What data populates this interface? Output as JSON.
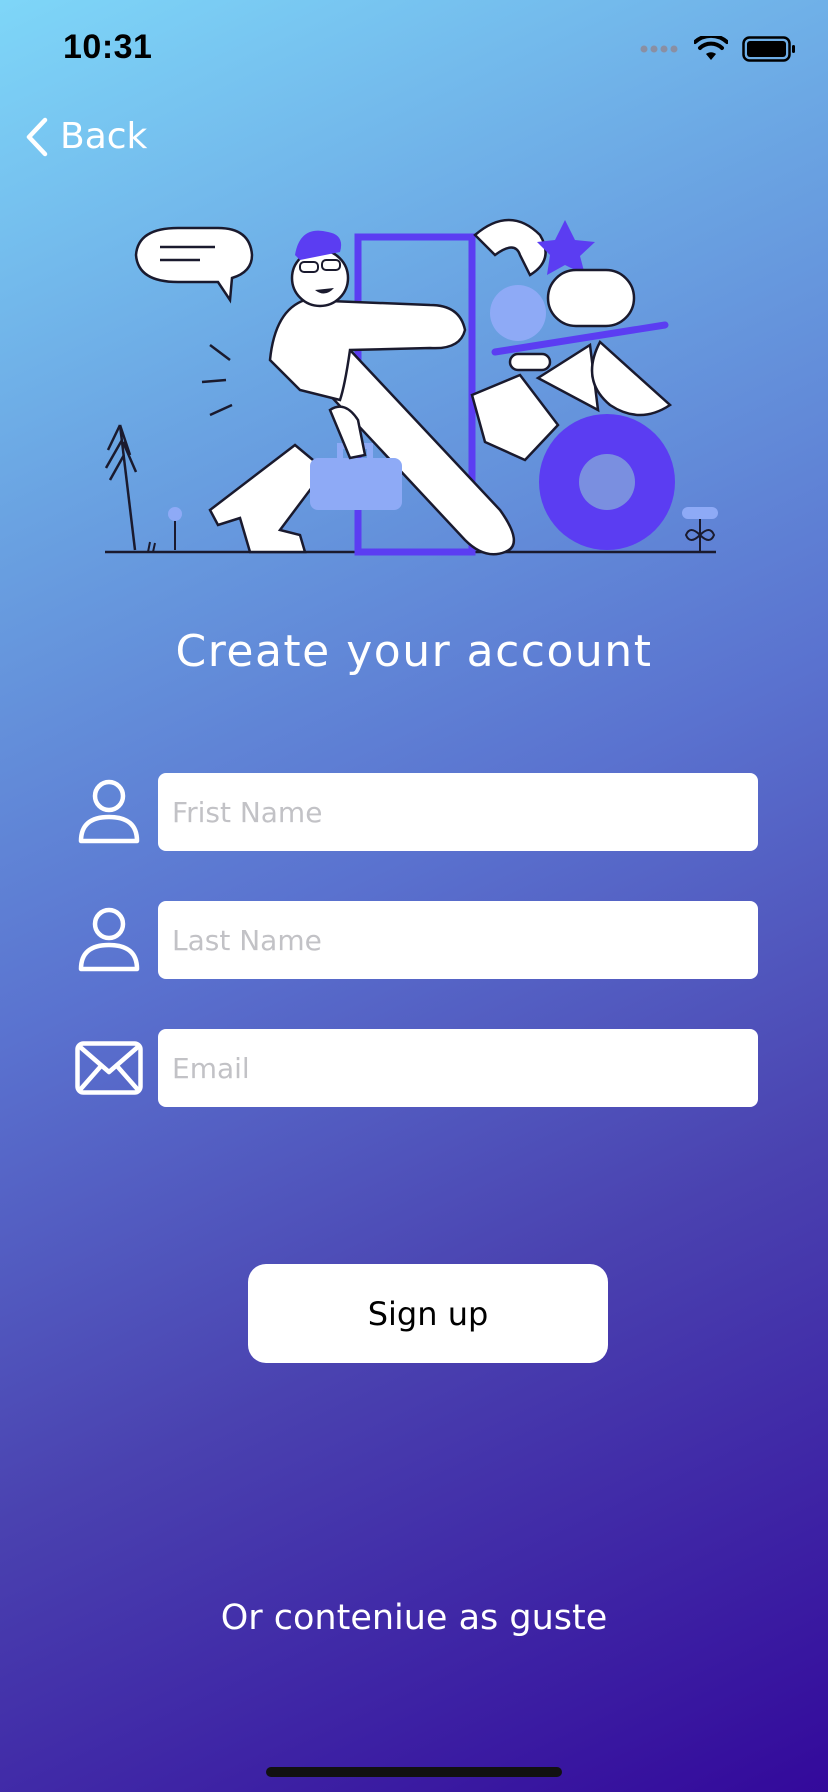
{
  "status_bar": {
    "time": "10:31",
    "icons": [
      "cellular-dots-icon",
      "wifi-icon",
      "battery-icon"
    ]
  },
  "nav": {
    "back_label": "Back",
    "back_icon": "chevron-left-icon"
  },
  "illustration": {
    "description_icon": "signup-illustration",
    "accent": "#5b3df2",
    "light_accent": "#8eaaf6"
  },
  "page": {
    "title": "Create your account"
  },
  "form": {
    "first_name": {
      "icon": "person-icon",
      "placeholder": "Frist Name",
      "value": ""
    },
    "last_name": {
      "icon": "person-icon",
      "placeholder": "Last Name",
      "value": ""
    },
    "email": {
      "icon": "envelope-icon",
      "placeholder": "Email",
      "value": ""
    }
  },
  "actions": {
    "signup_label": "Sign up",
    "guest_label": "Or conteniue as guste"
  },
  "colors": {
    "gradient_start": "#7ed6f8",
    "gradient_end": "#33099b",
    "text": "#ffffff",
    "button_bg": "#ffffff"
  }
}
